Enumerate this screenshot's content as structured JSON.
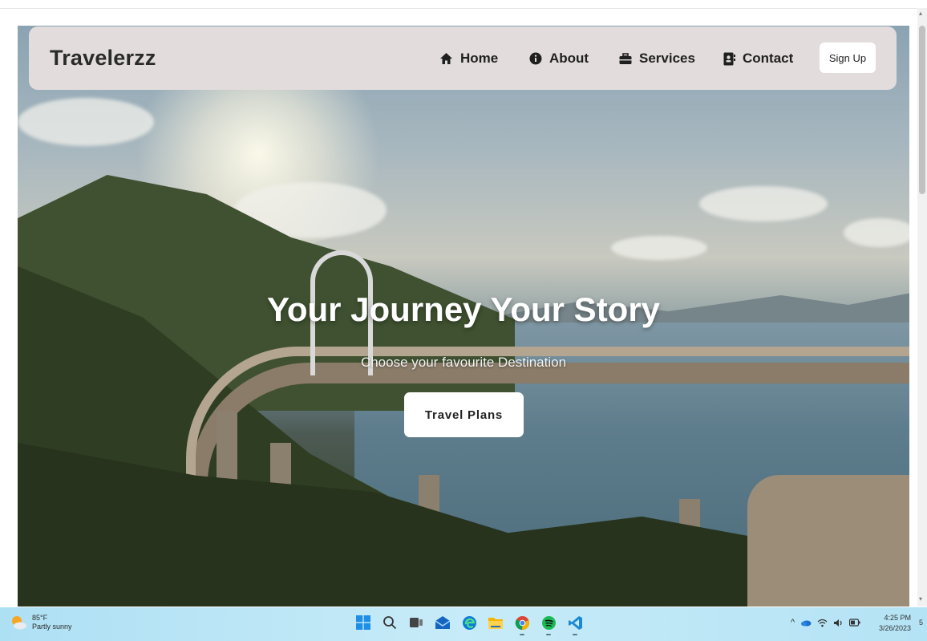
{
  "browser": {
    "scroll_up": "▴",
    "scroll_down": "▾"
  },
  "navbar": {
    "brand": "Travelerzz",
    "links": [
      {
        "label": "Home",
        "icon": "home-icon"
      },
      {
        "label": "About",
        "icon": "info-icon"
      },
      {
        "label": "Services",
        "icon": "briefcase-icon"
      },
      {
        "label": "Contact",
        "icon": "address-book-icon"
      }
    ],
    "signup_label": "Sign Up"
  },
  "hero": {
    "headline": "Your Journey Your Story",
    "subtitle": "Choose your favourite Destination",
    "cta_label": "Travel Plans"
  },
  "taskbar": {
    "weather_temp": "85°F",
    "weather_desc": "Partly sunny",
    "apps": [
      "windows-start-icon",
      "search-icon",
      "task-view-icon",
      "mail-icon",
      "edge-icon",
      "file-explorer-icon",
      "chrome-icon",
      "spotify-icon",
      "vscode-icon"
    ],
    "tray_chevron": "^",
    "time": "4:25 PM",
    "date": "3/26/2023",
    "notification_count": "5"
  },
  "colors": {
    "navbar_bg": "#e2dcdc",
    "button_bg": "#ffffff",
    "taskbar_bg": "#c7ebf8"
  }
}
